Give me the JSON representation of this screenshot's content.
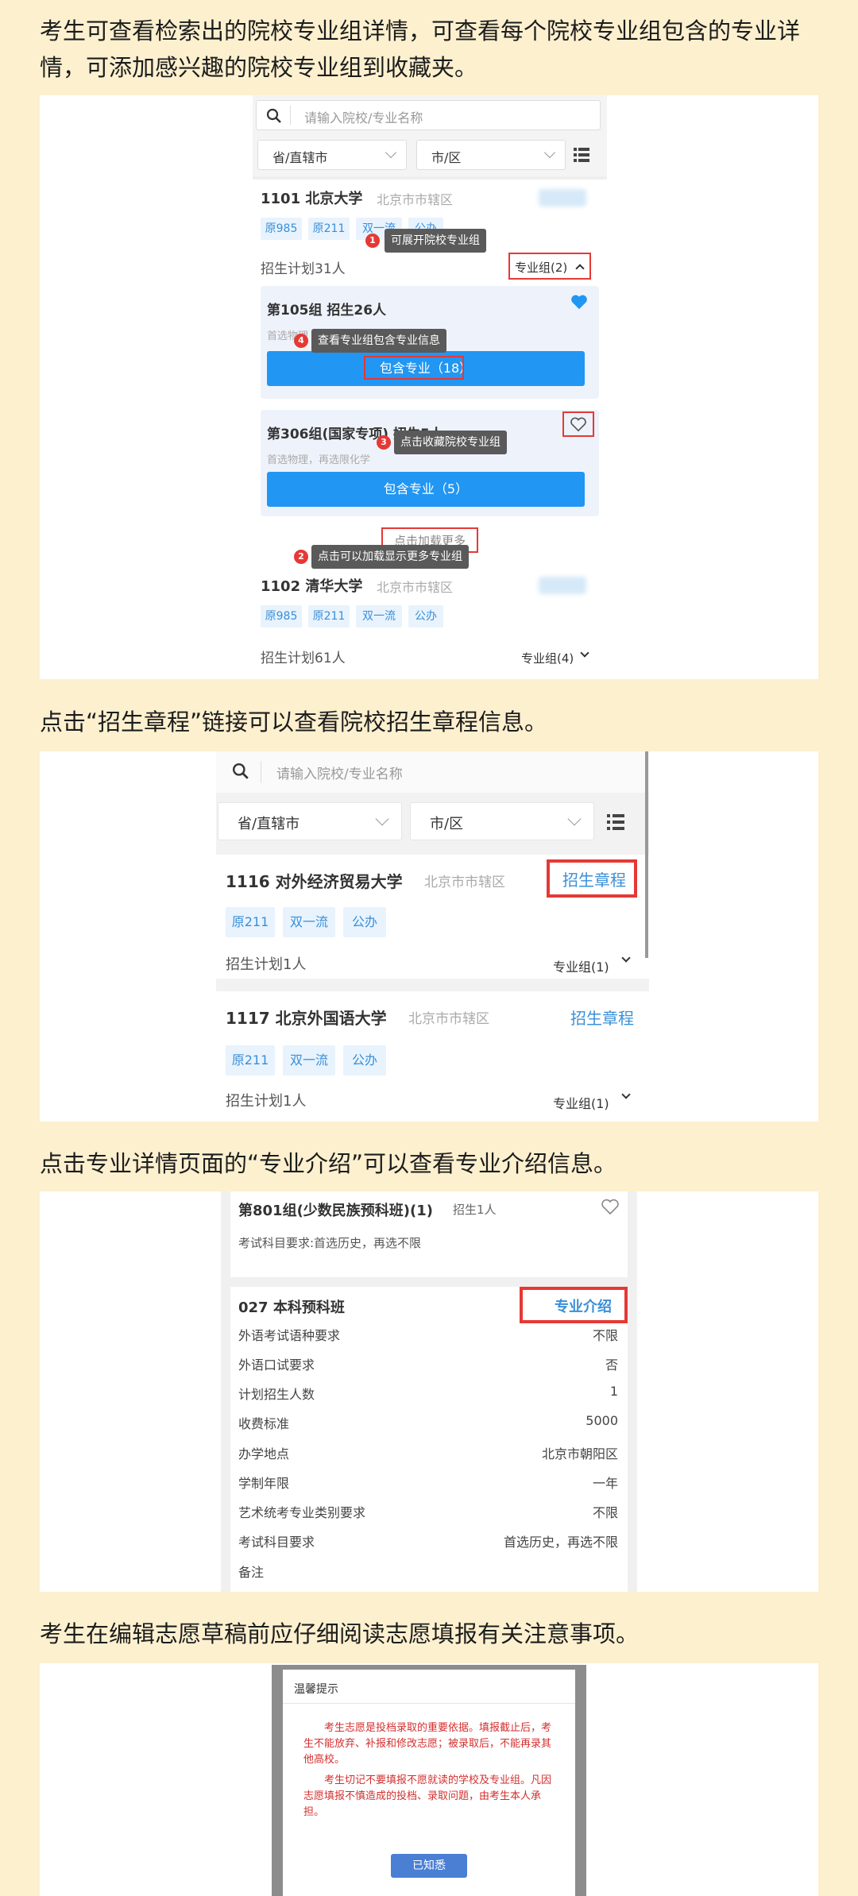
{
  "sections": {
    "s1": {
      "intro": "考生可查看检索出的院校专业组详情，可查看每个院校专业组包含的专业详情，可添加感兴趣的院校专业组到收藏夹。"
    },
    "s2": {
      "intro": "点击“招生章程”链接可以查看院校招生章程信息。"
    },
    "s3": {
      "intro": "点击专业详情页面的“专业介绍”可以查看专业介绍信息。"
    },
    "s4": {
      "intro": "考生在编辑志愿草稿前应仔细阅读志愿填报有关注意事项。"
    }
  },
  "search": {
    "placeholder": "请输入院校/专业名称"
  },
  "filters": {
    "province": "省/直辖市",
    "city": "市/区"
  },
  "shot1": {
    "uni1": {
      "name": "1101 北京大学",
      "location": "北京市市辖区",
      "tags": [
        "原985",
        "原211",
        "双一流",
        "公办"
      ],
      "plan": "招生计划31人",
      "group_link": "专业组(2)"
    },
    "group1": {
      "title": "第105组  招生26人",
      "subject": "首选物理",
      "button": "包含专业（18）"
    },
    "group2": {
      "title": "第306组(国家专项)  招生5人",
      "subject": "首选物理，再选限化学",
      "button": "包含专业（5）"
    },
    "load_more": "点击加载更多",
    "uni2": {
      "name": "1102 清华大学",
      "location": "北京市市辖区",
      "tags": [
        "原985",
        "原211",
        "双一流",
        "公办"
      ],
      "plan": "招生计划61人",
      "group_link": "专业组(4)"
    },
    "callouts": {
      "c1": {
        "num": "1",
        "text": "可展开院校专业组"
      },
      "c2": {
        "num": "2",
        "text": "点击可以加载显示更多专业组"
      },
      "c3": {
        "num": "3",
        "text": "点击收藏院校专业组"
      },
      "c4": {
        "num": "4",
        "text": "查看专业组包含专业信息"
      }
    }
  },
  "shot2": {
    "uni1": {
      "name": "1116 对外经济贸易大学",
      "location": "北京市市辖区",
      "charter": "招生章程",
      "tags": [
        "原211",
        "双一流",
        "公办"
      ],
      "plan": "招生计划1人",
      "group_link": "专业组(1)"
    },
    "uni2": {
      "name": "1117 北京外国语大学",
      "location": "北京市市辖区",
      "charter": "招生章程",
      "tags": [
        "原211",
        "双一流",
        "公办"
      ],
      "plan": "招生计划1人",
      "group_link": "专业组(1)"
    }
  },
  "shot3": {
    "group_title": "第801组(少数民族预科班)(1)",
    "group_count": "招生1人",
    "group_subject": "考试科目要求:首选历史，再选不限",
    "major_title": "027 本科预科班",
    "major_intro": "专业介绍",
    "rows": [
      {
        "label": "外语考试语种要求",
        "value": "不限"
      },
      {
        "label": "外语口试要求",
        "value": "否"
      },
      {
        "label": "计划招生人数",
        "value": "1"
      },
      {
        "label": "收费标准",
        "value": "5000"
      },
      {
        "label": "办学地点",
        "value": "北京市朝阳区"
      },
      {
        "label": "学制年限",
        "value": "一年"
      },
      {
        "label": "艺术统考专业类别要求",
        "value": "不限"
      },
      {
        "label": "考试科目要求",
        "value": "首选历史，再选不限"
      },
      {
        "label": "备注",
        "value": ""
      }
    ]
  },
  "shot4": {
    "title": "温馨提示",
    "para1": "考生志愿是投档录取的重要依据。填报截止后，考生不能放弃、补报和修改志愿；被录取后，不能再录其他高校。",
    "para2": "考生切记不要填报不愿就读的学校及专业组。凡因志愿填报不慎造成的投档、录取问题，由考生本人承担。",
    "button": "已知悉"
  },
  "colors": {
    "background": "#fdf0cf",
    "accent_blue": "#2196f3",
    "highlight_red": "#e53935",
    "link_blue": "#3a8fd8"
  }
}
